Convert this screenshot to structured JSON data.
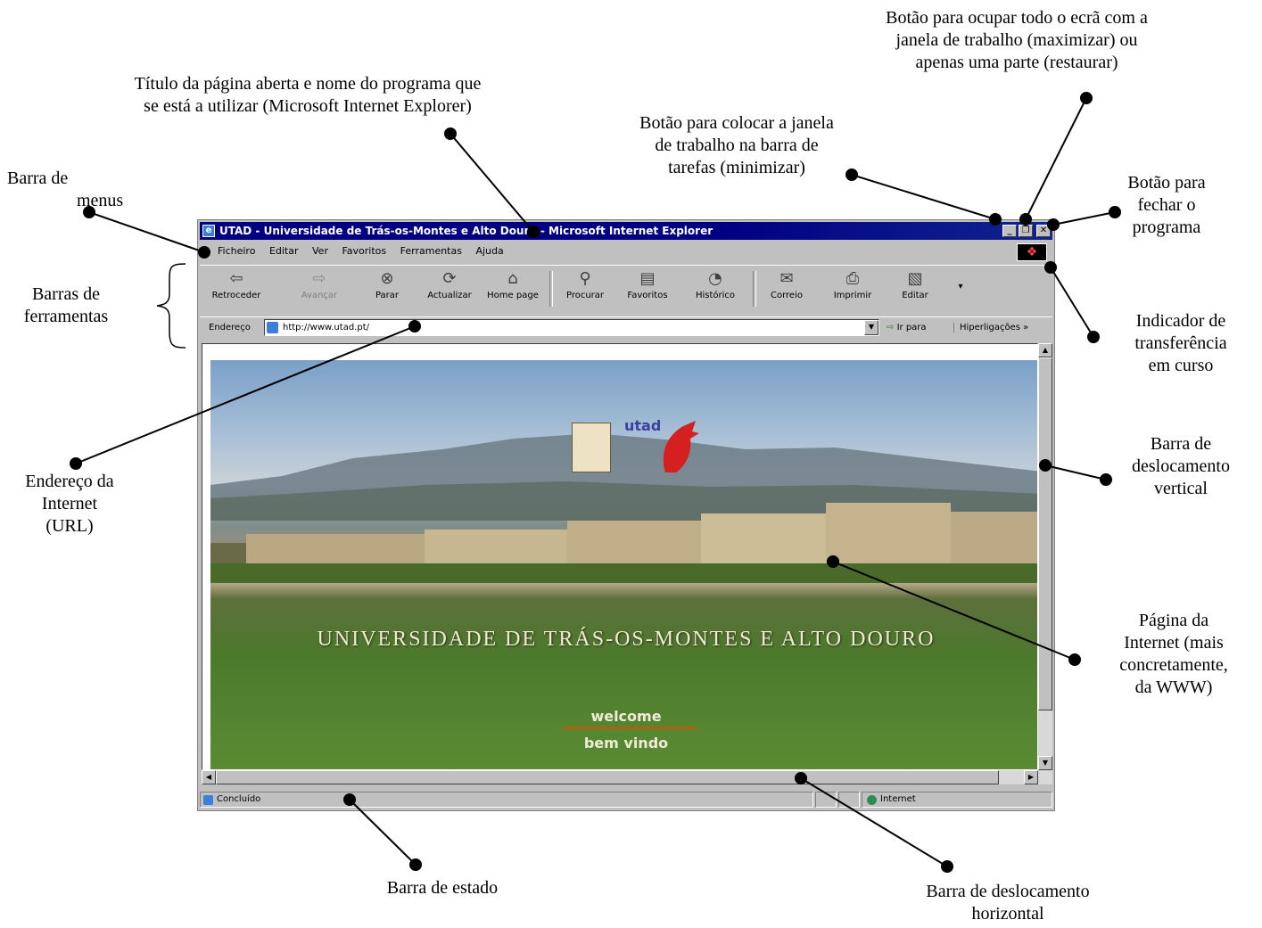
{
  "annotations": {
    "title_bar": [
      "Título da página aberta e nome do programa que",
      "se está a utilizar (Microsoft Internet Explorer)"
    ],
    "maximize": [
      "Botão para ocupar todo o ecrã com a",
      "janela de trabalho (maximizar) ou",
      "apenas uma parte (restaurar)"
    ],
    "minimize": [
      "Botão para colocar a janela",
      "de trabalho na barra de",
      "tarefas (minimizar)"
    ],
    "close": [
      "Botão para",
      "fechar o",
      "programa"
    ],
    "menu_bar": [
      "Barra de",
      "menus"
    ],
    "toolbars": [
      "Barras de",
      "ferramentas"
    ],
    "throbber": [
      "Indicador de",
      "transferência",
      "em curso"
    ],
    "address": [
      "Endereço da",
      "Internet",
      "(URL)"
    ],
    "vscroll": [
      "Barra de",
      "deslocamento",
      "vertical"
    ],
    "web_page": [
      "Página da",
      "Internet (mais",
      "concretamente,",
      "da WWW)"
    ],
    "status_bar": [
      "Barra de estado"
    ],
    "hscroll": [
      "Barra de deslocamento",
      "horizontal"
    ]
  },
  "browser": {
    "title": "UTAD - Universidade de Trás-os-Montes e Alto Douro - Microsoft Internet Explorer",
    "menu": [
      "Ficheiro",
      "Editar",
      "Ver",
      "Favoritos",
      "Ferramentas",
      "Ajuda"
    ],
    "toolbar": {
      "back": "Retroceder",
      "forward": "Avançar",
      "stop": "Parar",
      "refresh": "Actualizar",
      "home": "Home page",
      "search": "Procurar",
      "favorites": "Favoritos",
      "history": "Histórico",
      "mail": "Correio",
      "print": "Imprimir",
      "edit": "Editar"
    },
    "address_label": "Endereço",
    "url": "http://www.utad.pt/",
    "go_label": "Ir para",
    "links_label": "Hiperligações »",
    "status_text": "Concluído",
    "zone_text": "Internet"
  },
  "page": {
    "logo_text": "utad",
    "heading": "UNIVERSIDADE DE TRÁS-OS-MONTES E ALTO DOURO",
    "welcome": "welcome",
    "bem_vindo": "bem vindo"
  },
  "colors": {
    "titlebar": "#000080",
    "chrome": "#c0c0c0",
    "accent_line": "#b06010"
  }
}
